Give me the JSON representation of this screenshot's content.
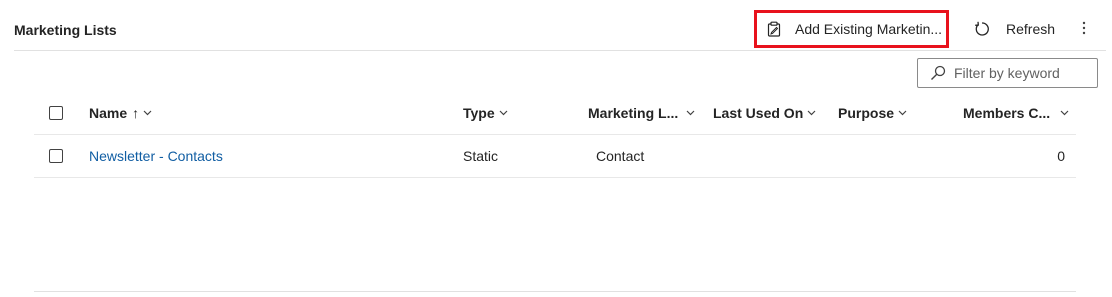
{
  "title": "Marketing Lists",
  "commands": {
    "add_existing": "Add Existing Marketin...",
    "refresh": "Refresh"
  },
  "filter": {
    "placeholder": "Filter by keyword"
  },
  "columns": [
    {
      "label": "Name",
      "sort": "↑"
    },
    {
      "label": "Type"
    },
    {
      "label": "Marketing L..."
    },
    {
      "label": "Last Used On"
    },
    {
      "label": "Purpose"
    },
    {
      "label": "Members C..."
    }
  ],
  "rows": [
    {
      "name": "Newsletter - Contacts",
      "type": "Static",
      "marketing_list_type": "Contact",
      "last_used_on": "",
      "purpose": "",
      "members_count": "0"
    }
  ]
}
